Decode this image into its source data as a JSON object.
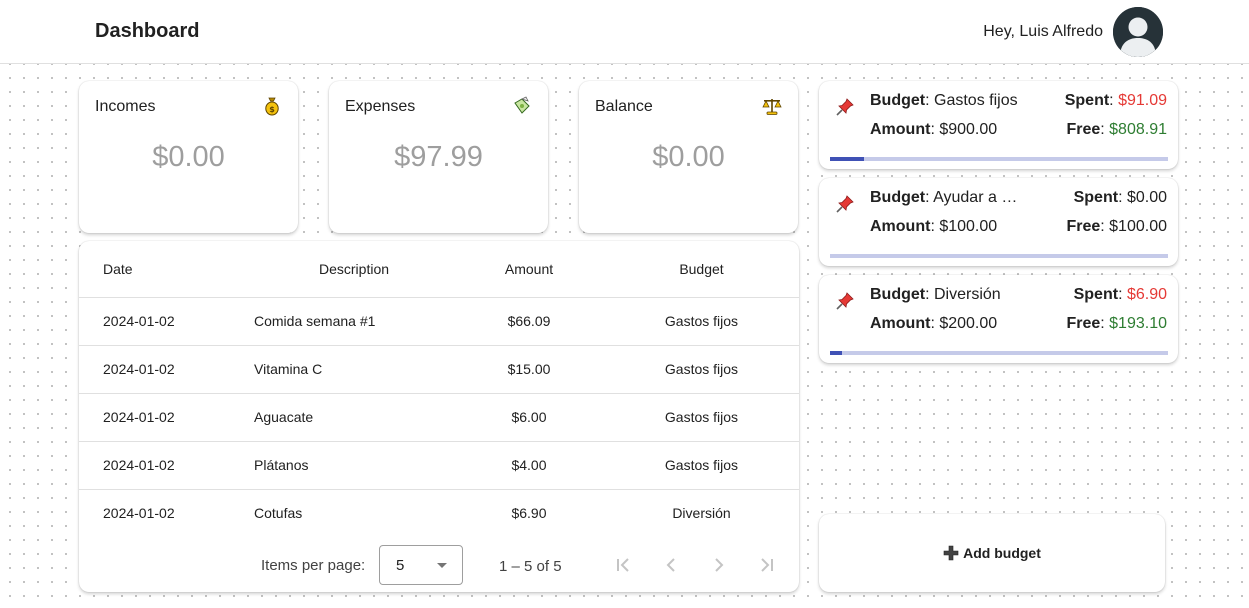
{
  "header": {
    "title": "Dashboard",
    "greeting": "Hey, Luis Alfredo"
  },
  "stats": [
    {
      "label": "Incomes",
      "value": "$0.00",
      "icon": "money-bag-icon"
    },
    {
      "label": "Expenses",
      "value": "$97.99",
      "icon": "money-wings-icon"
    },
    {
      "label": "Balance",
      "value": "$0.00",
      "icon": "balance-scale-icon"
    }
  ],
  "table": {
    "headers": [
      "Date",
      "Description",
      "Amount",
      "Budget"
    ],
    "rows": [
      [
        "2024-01-02",
        "Comida semana #1",
        "$66.09",
        "Gastos fijos"
      ],
      [
        "2024-01-02",
        "Vitamina C",
        "$15.00",
        "Gastos fijos"
      ],
      [
        "2024-01-02",
        "Aguacate",
        "$6.00",
        "Gastos fijos"
      ],
      [
        "2024-01-02",
        "Plátanos",
        "$4.00",
        "Gastos fijos"
      ],
      [
        "2024-01-02",
        "Cotufas",
        "$6.90",
        "Diversión"
      ]
    ]
  },
  "paginator": {
    "items_per_page_label": "Items per page:",
    "items_per_page_value": "5",
    "range_label": "1 – 5 of 5"
  },
  "budgets": {
    "budget_label": "Budget",
    "amount_label": "Amount",
    "spent_label": "Spent",
    "free_label": "Free",
    "items": [
      {
        "name": "Gastos fijos",
        "amount": "$900.00",
        "spent": "$91.09",
        "free": "$808.91",
        "progress": 0.1
      },
      {
        "name": "Ayudar a otros",
        "amount": "$100.00",
        "spent": "$0.00",
        "free": "$100.00",
        "progress": 0.0
      },
      {
        "name": "Diversión",
        "amount": "$200.00",
        "spent": "$6.90",
        "free": "$193.10",
        "progress": 0.035
      }
    ]
  },
  "add_budget": {
    "label": "Add budget"
  },
  "colors": {
    "accent": "#3f51b5",
    "track": "#c5cae9",
    "spent_red": "#e53935",
    "free_green": "#2e7d32",
    "muted_value": "#9e9e9e"
  }
}
